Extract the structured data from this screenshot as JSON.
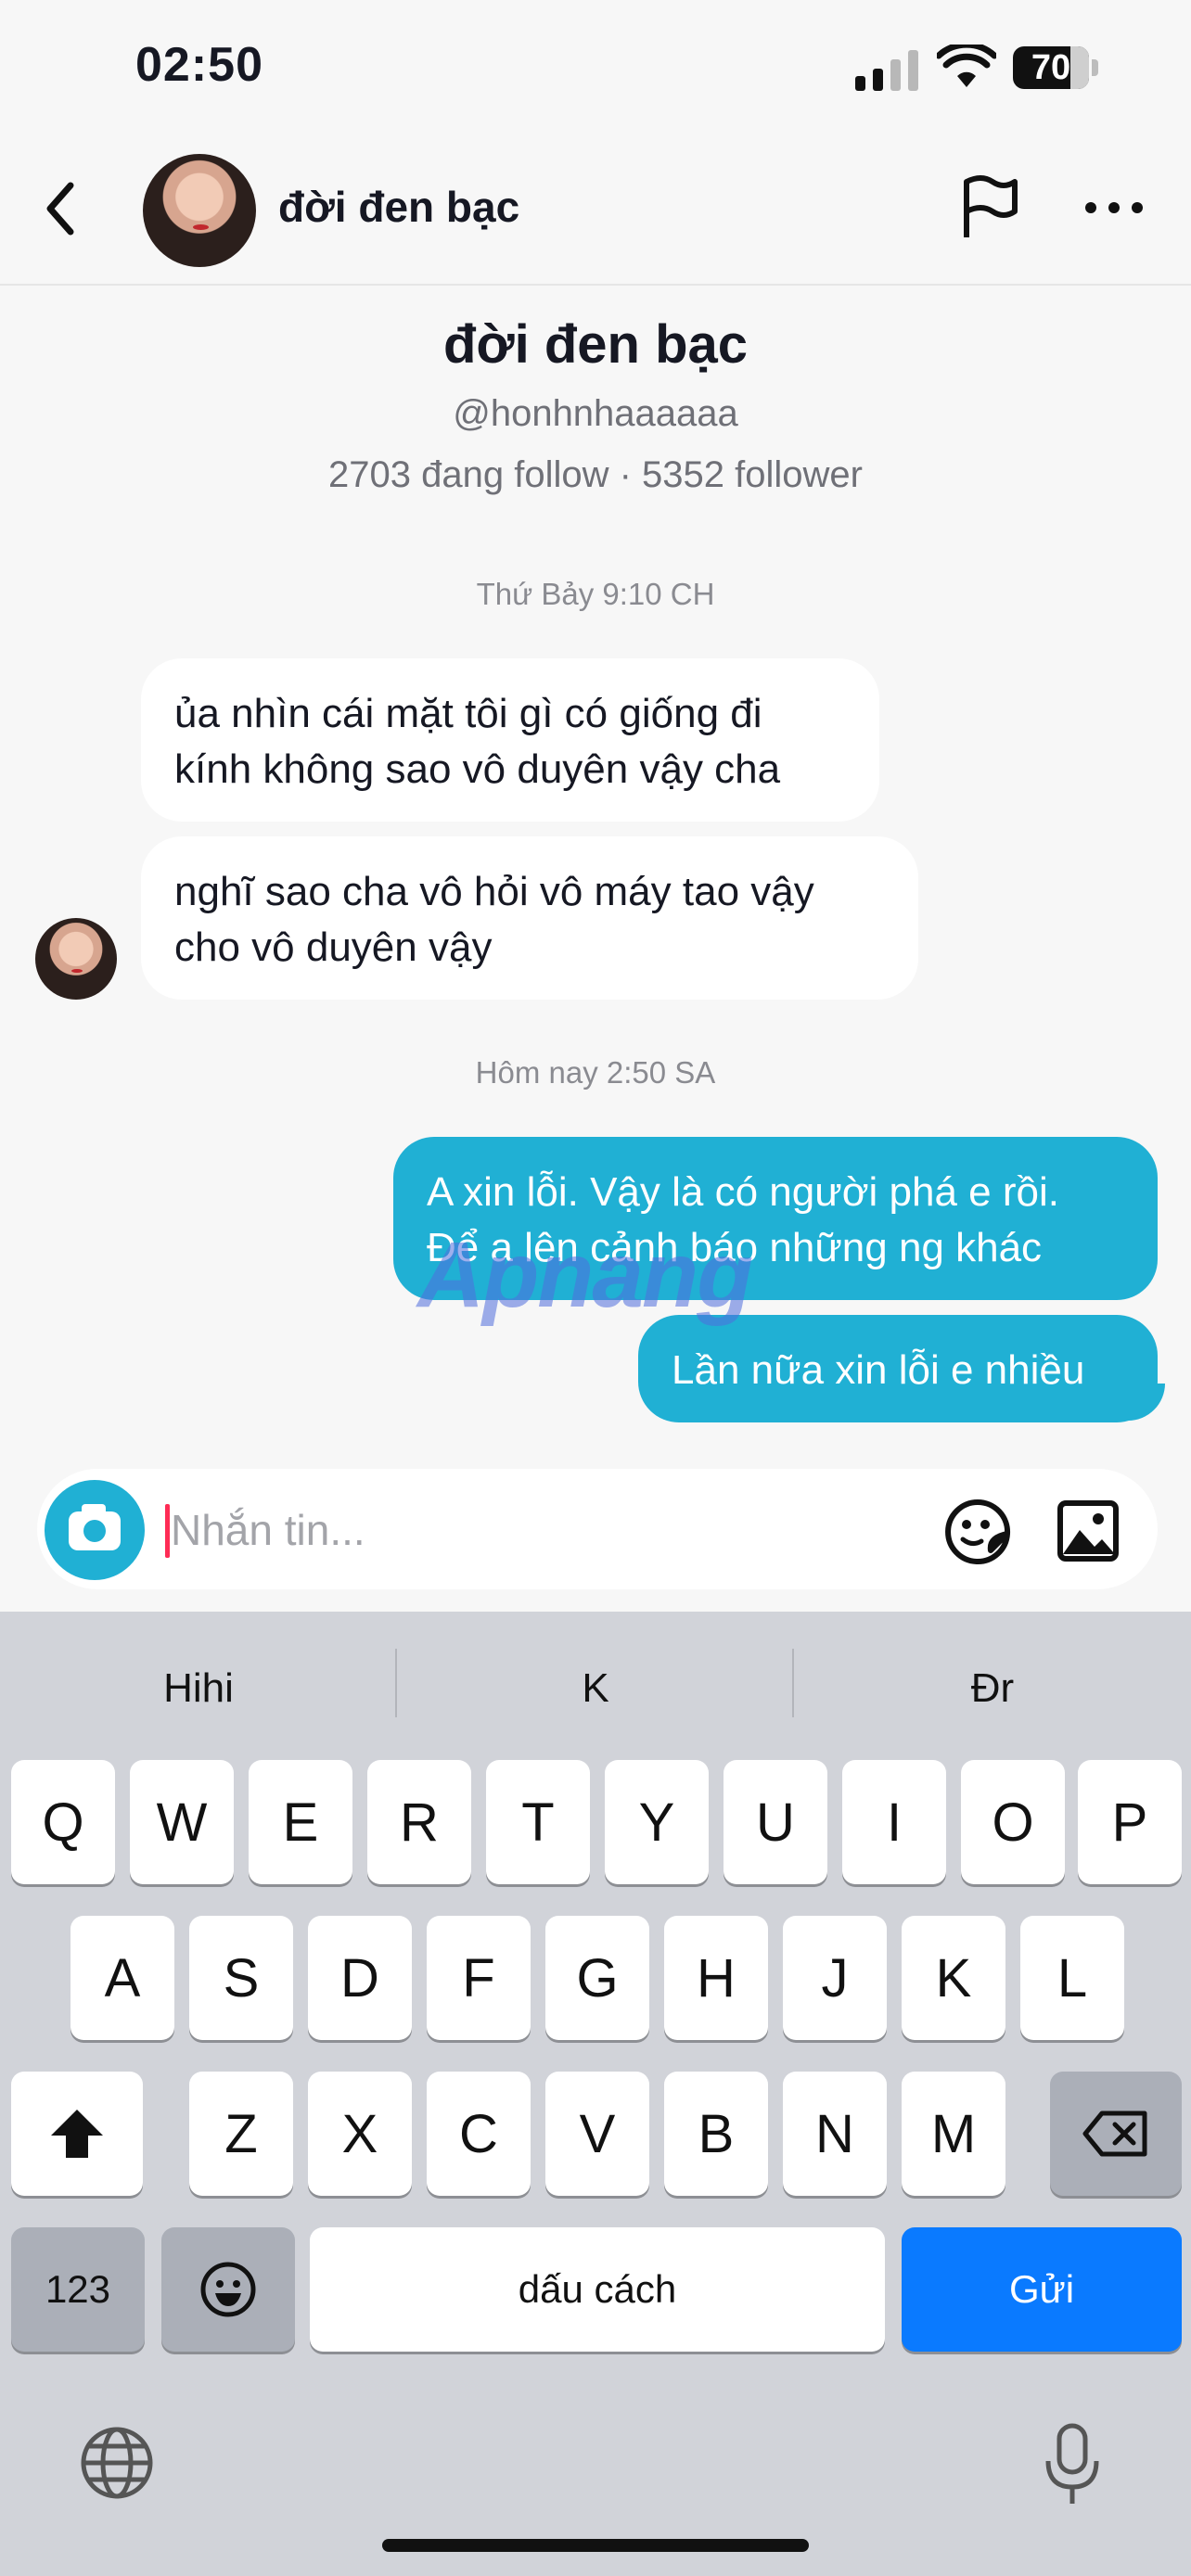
{
  "status_bar": {
    "time": "02:50",
    "battery": "70"
  },
  "header": {
    "title": "đời đen bạc"
  },
  "profile": {
    "name": "đời đen bạc",
    "handle": "@honhnhaaaaaa",
    "stats": "2703 đang follow · 5352 follower"
  },
  "conversation": {
    "timestamp_1": "Thứ Bảy 9:10 CH",
    "incoming": [
      {
        "line1": "ủa nhìn cái mặt tôi gì có giống đi",
        "line2": "kính không sao vô duyên vậy cha"
      },
      {
        "line1": "nghĩ sao cha vô hỏi vô máy tao vậy",
        "line2": "cho vô duyên vậy"
      }
    ],
    "timestamp_2": "Hôm nay 2:50 SA",
    "outgoing": [
      {
        "line1": "A xin lỗi. Vậy là có người phá e rồi.",
        "line2": "Để a lên cảnh báo những ng khác"
      },
      {
        "line1": "Lần nữa xin lỗi e nhiều"
      }
    ]
  },
  "watermark": "Apnang",
  "composer": {
    "placeholder": "Nhắn tin..."
  },
  "keyboard": {
    "suggestions": [
      "Hihi",
      "K",
      "Đr"
    ],
    "row1": [
      "Q",
      "W",
      "E",
      "R",
      "T",
      "Y",
      "U",
      "I",
      "O",
      "P"
    ],
    "row2": [
      "A",
      "S",
      "D",
      "F",
      "G",
      "H",
      "J",
      "K",
      "L"
    ],
    "row3": [
      "Z",
      "X",
      "C",
      "V",
      "B",
      "N",
      "M"
    ],
    "numbers_label": "123",
    "space_label": "dấu cách",
    "send_label": "Gửi"
  },
  "colors": {
    "accent": "#20b0d4",
    "send_key": "#0a7aff",
    "cursor": "#fe2c55"
  }
}
